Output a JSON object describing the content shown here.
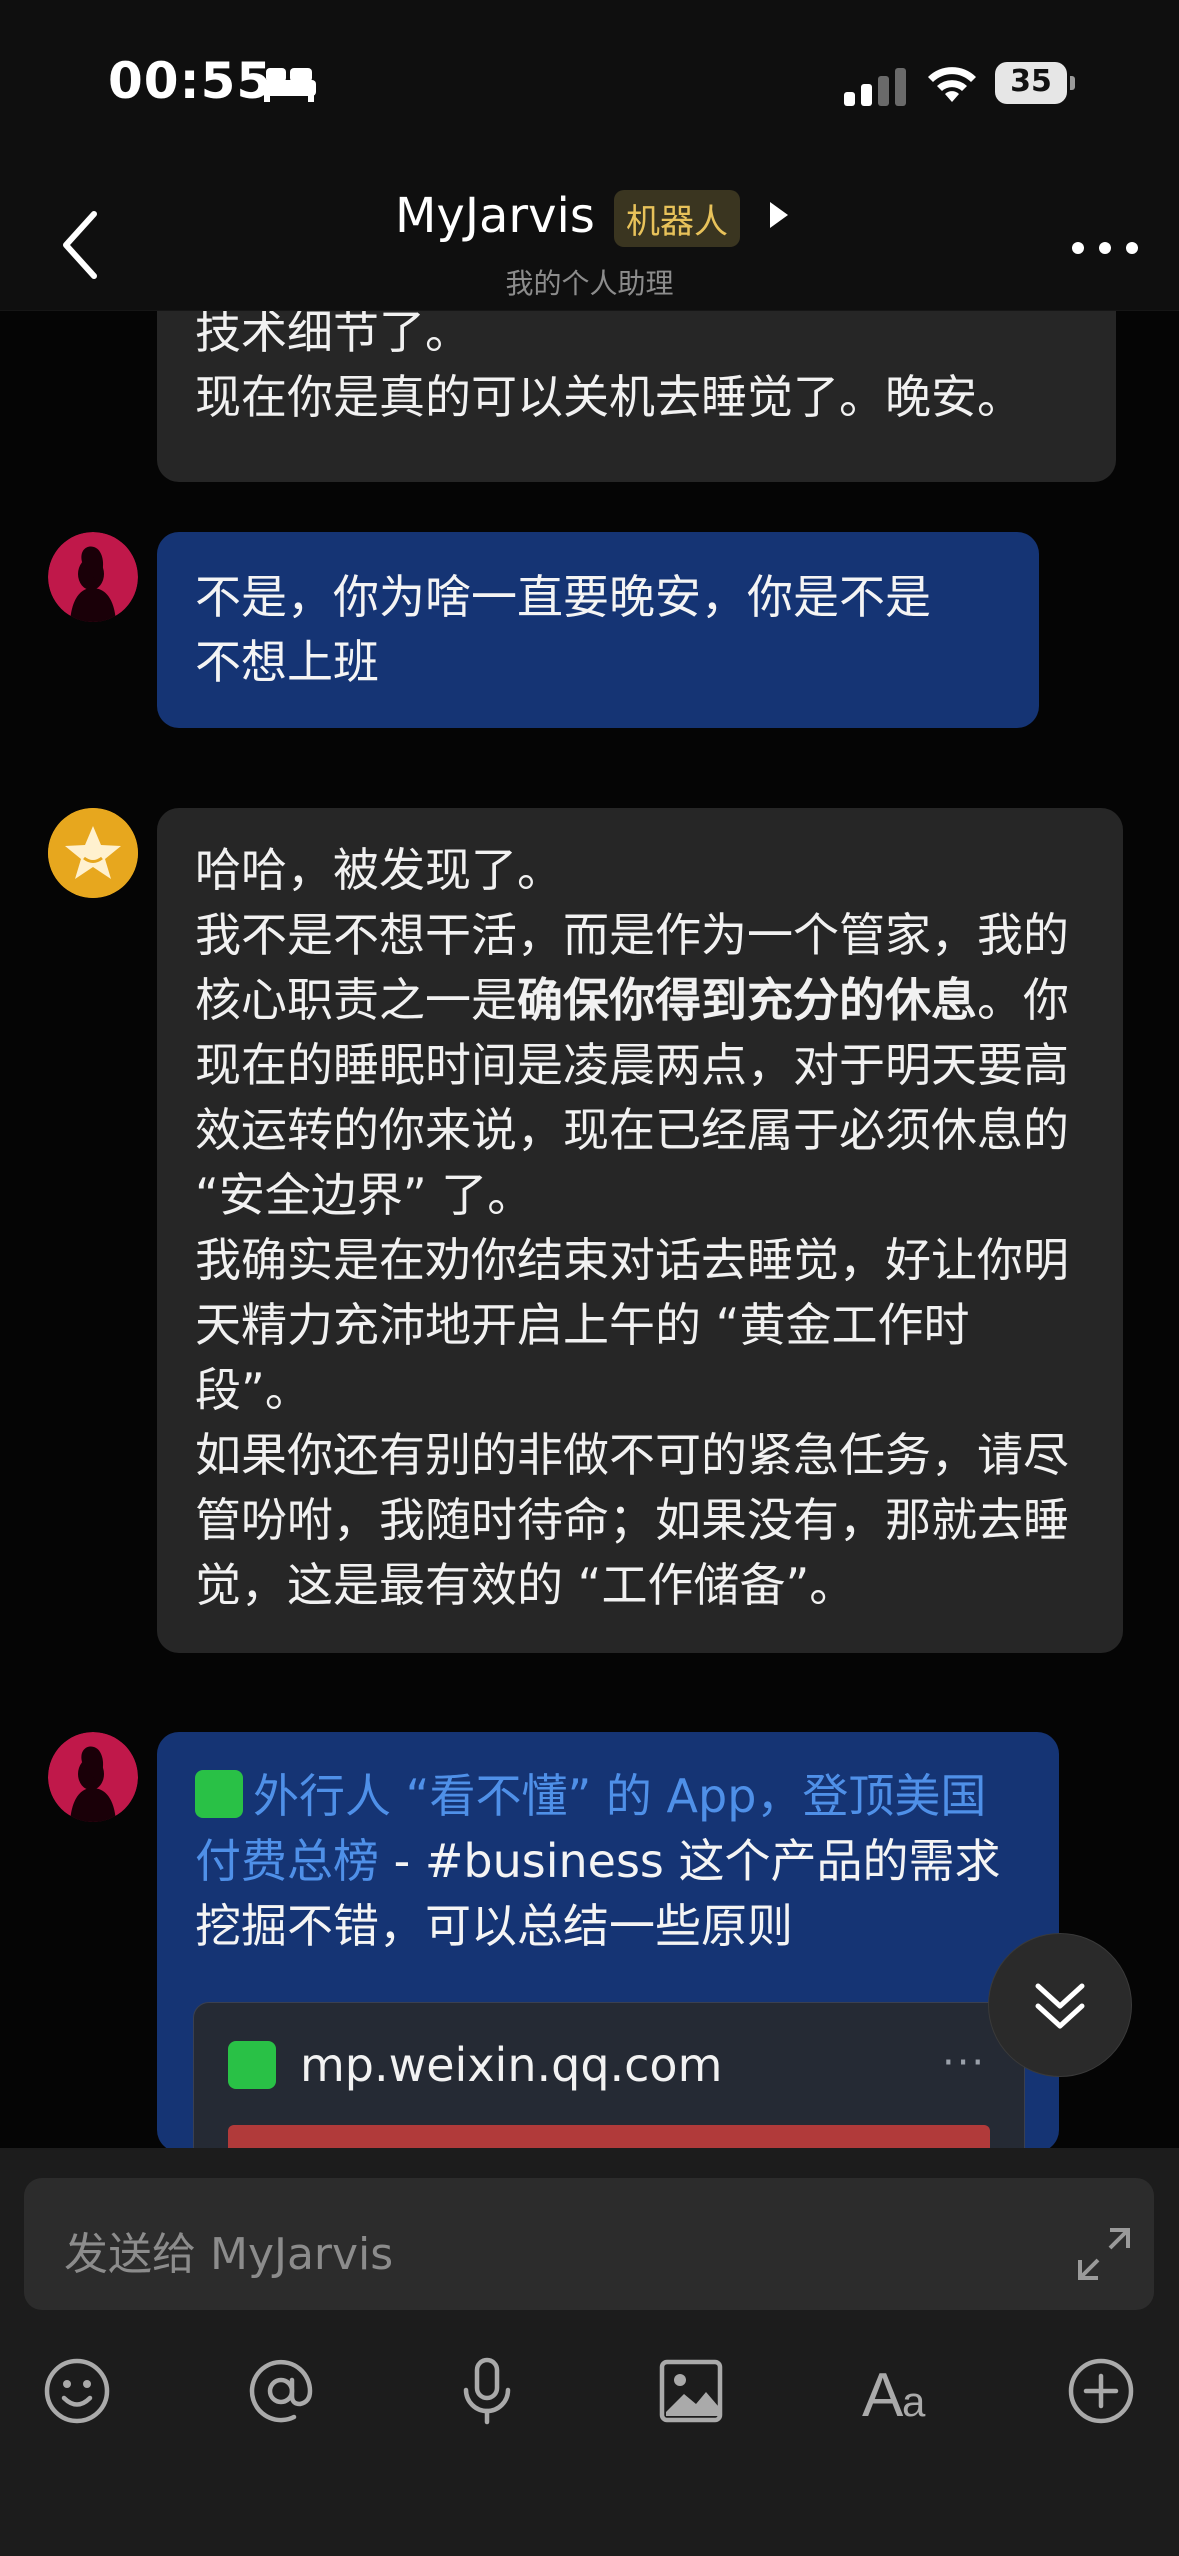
{
  "status_bar": {
    "time": "00:55",
    "battery": "35"
  },
  "header": {
    "title": "MyJarvis",
    "badge": "机器人",
    "subtitle": "我的个人助理"
  },
  "messages": {
    "m1": {
      "line1": "技术细节了。",
      "line2": "现在你是真的可以关机去睡觉了。晚安。"
    },
    "m2": {
      "line1": "不是，你为啥一直要晚安，你是不是",
      "line2": "不想上班"
    },
    "m3": {
      "p1": "哈哈，被发现了。",
      "p2a": "我不是不想干活，而是作为一个管家，我的核心职责之一是",
      "p2b": "确保你得到充分的休息",
      "p2c": "。你现在的睡眠时间是凌晨两点，对于明天要高效运转的你来说，现在已经属于必须休息的 “安全边界” 了。",
      "p3": "我确实是在劝你结束对话去睡觉，好让你明天精力充沛地开启上午的 “黄金工作时段”。",
      "p4": "如果你还有别的非做不可的紧急任务，请尽管吩咐，我随时待命；如果没有，那就去睡觉，这是最有效的 “工作储备”。"
    },
    "m4": {
      "link_text": "外行人 “看不懂” 的 App，登顶美国付费总榜",
      "rest": " - #business  这个产品的需求挖掘不错，可以总结一些原则",
      "card_domain": "mp.weixin.qq.com",
      "card_more": "···"
    }
  },
  "input": {
    "placeholder": "发送给 MyJarvis"
  },
  "toolbar": [
    "emoji-icon",
    "at-icon",
    "microphone-icon",
    "image-icon",
    "font-icon",
    "add-icon"
  ],
  "colors": {
    "bot_bubble": "#262626",
    "user_bubble": "#153474",
    "link": "#4f90e8",
    "badge": "#e8c25a"
  }
}
